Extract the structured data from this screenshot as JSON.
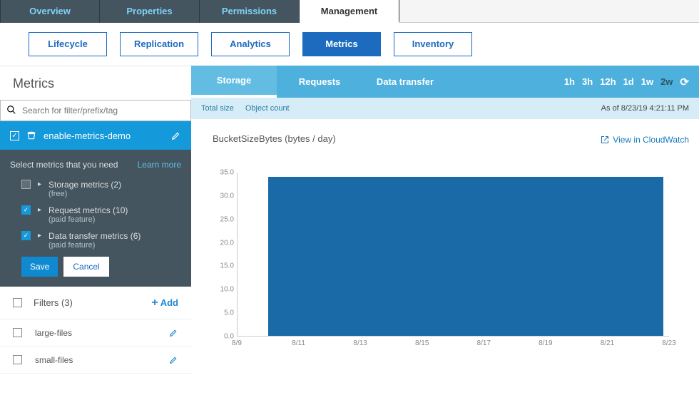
{
  "main_tabs": [
    "Overview",
    "Properties",
    "Permissions",
    "Management"
  ],
  "main_tabs_active": 3,
  "sub_tabs": [
    "Lifecycle",
    "Replication",
    "Analytics",
    "Metrics",
    "Inventory"
  ],
  "sub_tabs_active": 3,
  "left": {
    "heading": "Metrics",
    "search_placeholder": "Search for filter/prefix/tag",
    "bucket_label": "enable-metrics-demo",
    "select_hdr": "Select metrics that you need",
    "learn_more": "Learn more",
    "options": [
      {
        "label": "Storage metrics (2)",
        "sub": "(free)",
        "checked": false
      },
      {
        "label": "Request metrics (10)",
        "sub": "(paid feature)",
        "checked": true
      },
      {
        "label": "Data transfer metrics (6)",
        "sub": "(paid feature)",
        "checked": true
      }
    ],
    "save": "Save",
    "cancel": "Cancel",
    "filters_label": "Filters (3)",
    "add_label": "Add",
    "filters": [
      "large-files",
      "small-files"
    ]
  },
  "right": {
    "sec_tabs": [
      "Storage",
      "Requests",
      "Data transfer"
    ],
    "sec_tabs_active": 0,
    "time_ranges": [
      "1h",
      "3h",
      "12h",
      "1d",
      "1w",
      "2w"
    ],
    "time_ranges_active": 5,
    "sub_links": [
      "Total size",
      "Object count"
    ],
    "timestamp": "As of 8/23/19 4:21:11 PM",
    "chart_title": "BucketSizeBytes (bytes / day)",
    "cloudwatch": "View in CloudWatch"
  },
  "chart_data": {
    "type": "bar",
    "title": "BucketSizeBytes (bytes / day)",
    "xlabel": "",
    "ylabel": "",
    "ylim": [
      0,
      35
    ],
    "y_ticks": [
      0.0,
      5.0,
      10.0,
      15.0,
      20.0,
      25.0,
      30.0,
      35.0
    ],
    "categories": [
      "8/9",
      "8/11",
      "8/13",
      "8/15",
      "8/17",
      "8/19",
      "8/21",
      "8/23"
    ],
    "data_span": {
      "x_start": "8/10",
      "x_end": "8/23",
      "value": 34
    }
  }
}
